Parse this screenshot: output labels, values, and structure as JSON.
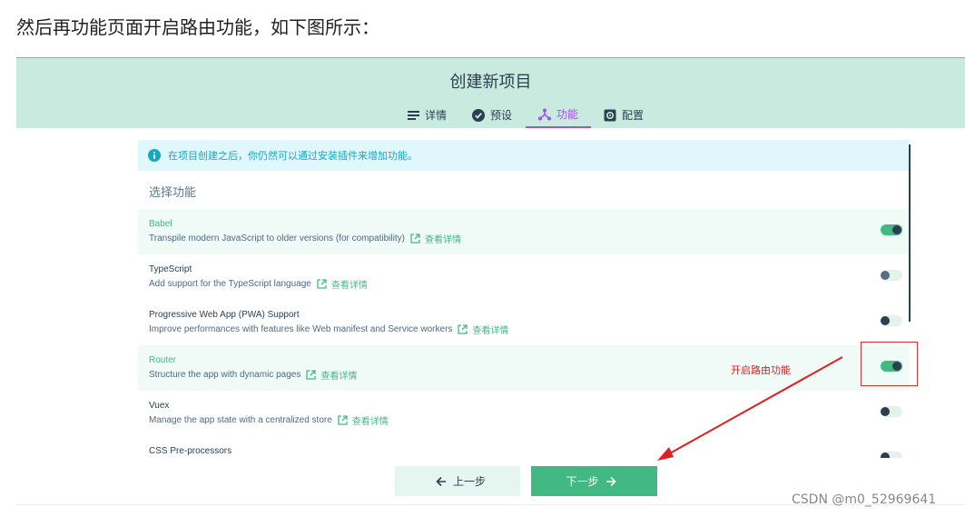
{
  "intro_text": "然后再功能页面开启路由功能，如下图所示：",
  "header": {
    "title": "创建新项目",
    "tabs": [
      {
        "label": "详情",
        "icon": "list-icon",
        "active": false
      },
      {
        "label": "预设",
        "icon": "check-circle-icon",
        "active": false
      },
      {
        "label": "功能",
        "icon": "tree-icon",
        "active": true
      },
      {
        "label": "配置",
        "icon": "gear-icon",
        "active": false
      }
    ]
  },
  "info": {
    "text": "在项目创建之后，你仍然可以通过安装插件来增加功能。"
  },
  "section_title": "选择功能",
  "more_label": "查看详情",
  "features": [
    {
      "name": "Babel",
      "desc": "Transpile modern JavaScript to older versions (for compatibility)",
      "enabled": true
    },
    {
      "name": "TypeScript",
      "desc": "Add support for the TypeScript language",
      "enabled": false
    },
    {
      "name": "Progressive Web App (PWA) Support",
      "desc": "Improve performances with features like Web manifest and Service workers",
      "enabled": false
    },
    {
      "name": "Router",
      "desc": "Structure the app with dynamic pages",
      "enabled": true
    },
    {
      "name": "Vuex",
      "desc": "Manage the app state with a centralized store",
      "enabled": false
    },
    {
      "name": "CSS Pre-processors",
      "desc": "",
      "enabled": false
    }
  ],
  "buttons": {
    "prev": "上一步",
    "next": "下一步"
  },
  "annotation": {
    "text": "开启路由功能",
    "color": "#e02020"
  },
  "colors": {
    "accent": "#42b983",
    "header_bg": "#c9ebdf",
    "active_tab": "#a44cf6",
    "info": "#13a8c4"
  },
  "watermark": "CSDN @m0_52969641"
}
